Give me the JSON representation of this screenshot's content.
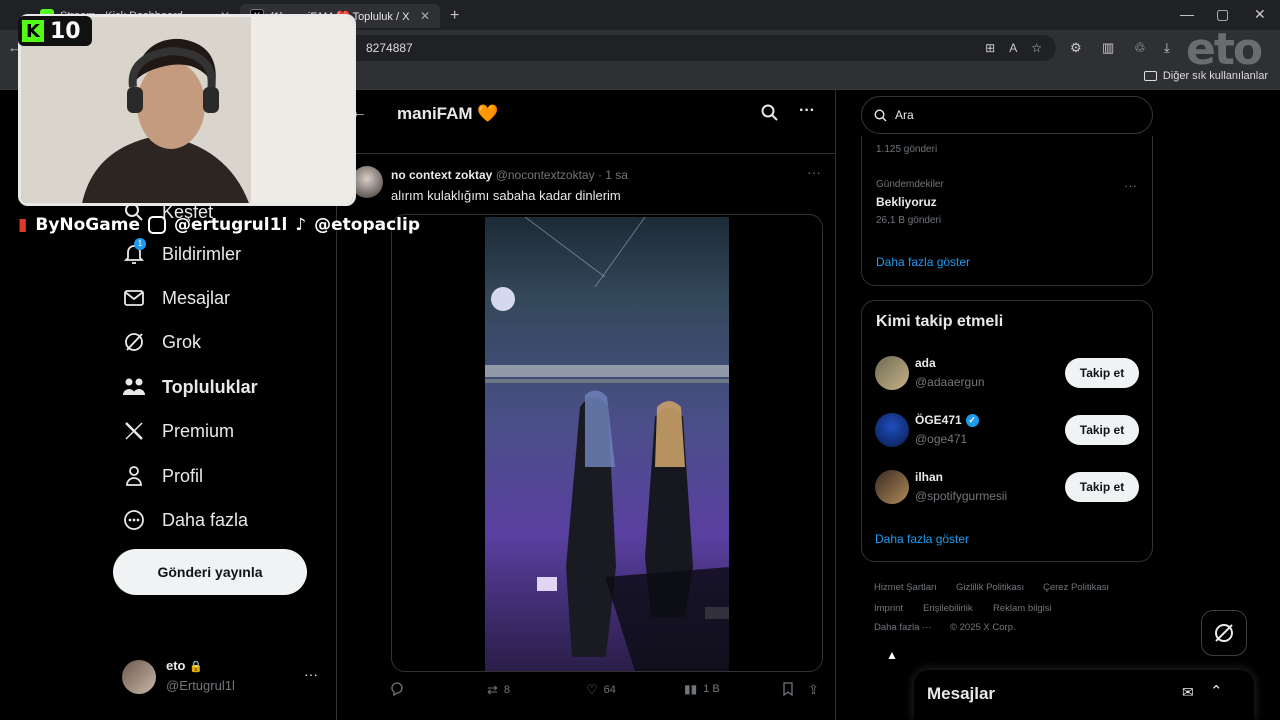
{
  "browser": {
    "tabs": [
      {
        "title": "Stream - Kick Dashboard"
      },
      {
        "title": "(1) maniFAM ❤️ Topluluk / X"
      }
    ],
    "url": "8274887",
    "bookmark_other": "Diğer sık kullanılanlar"
  },
  "overlay": {
    "kick_count": "10",
    "social_bynogame": "ByNoGame",
    "social_instagram": "@ertugrul1l",
    "social_tiktok": "@etopaclip",
    "watermark": "eto"
  },
  "sidebar": {
    "items": [
      {
        "label": "Keşfet",
        "icon": "search-icon"
      },
      {
        "label": "Bildirimler",
        "icon": "bell-icon",
        "badge": "1"
      },
      {
        "label": "Mesajlar",
        "icon": "mail-icon"
      },
      {
        "label": "Grok",
        "icon": "grok-icon"
      },
      {
        "label": "Topluluklar",
        "icon": "communities-icon"
      },
      {
        "label": "Premium",
        "icon": "x-logo-icon"
      },
      {
        "label": "Profil",
        "icon": "person-icon"
      },
      {
        "label": "Daha fazla",
        "icon": "more-circle-icon"
      }
    ],
    "post_button": "Gönderi yayınla",
    "account": {
      "name": "eto",
      "handle": "@Ertugrul1l"
    }
  },
  "header": {
    "title": "maniFAM 🧡"
  },
  "tweet": {
    "author": "no context zoktay",
    "handle": "@nocontextzoktay",
    "time": "· 1 sa",
    "text": "alırım kulaklığımı sabaha kadar dinlerim",
    "retweets": "8",
    "likes": "64",
    "views": "1 B"
  },
  "rightbar": {
    "search_placeholder": "Ara",
    "trend1_count": "1.125 gönderi",
    "trend2": {
      "category": "Gündemdekiler",
      "name": "Bekliyoruz",
      "count": "26,1 B gönderi"
    },
    "show_more": "Daha fazla göster",
    "who_to_follow": {
      "title": "Kimi takip etmeli",
      "users": [
        {
          "name": "ada",
          "handle": "@adaaergun",
          "button": "Takip et"
        },
        {
          "name": "ÖGE471",
          "handle": "@oge471",
          "button": "Takip et"
        },
        {
          "name": "ilhan",
          "handle": "@spotifygurmesii",
          "button": "Takip et"
        }
      ],
      "show_more": "Daha fazla göster"
    },
    "footer": {
      "terms": "Hizmet Şartları",
      "privacy": "Gizlilik Politikası",
      "cookies": "Çerez Politikası",
      "imprint": "Imprint",
      "accessibility": "Erişilebilirlik",
      "ads": "Reklam bilgisi",
      "more": "Daha fazla ···",
      "copyright": "© 2025 X Corp."
    }
  },
  "messages_bar": {
    "title": "Mesajlar"
  },
  "colors": {
    "accent": "#1d9bf0",
    "kick_green": "#53fc18",
    "background": "#000000"
  }
}
